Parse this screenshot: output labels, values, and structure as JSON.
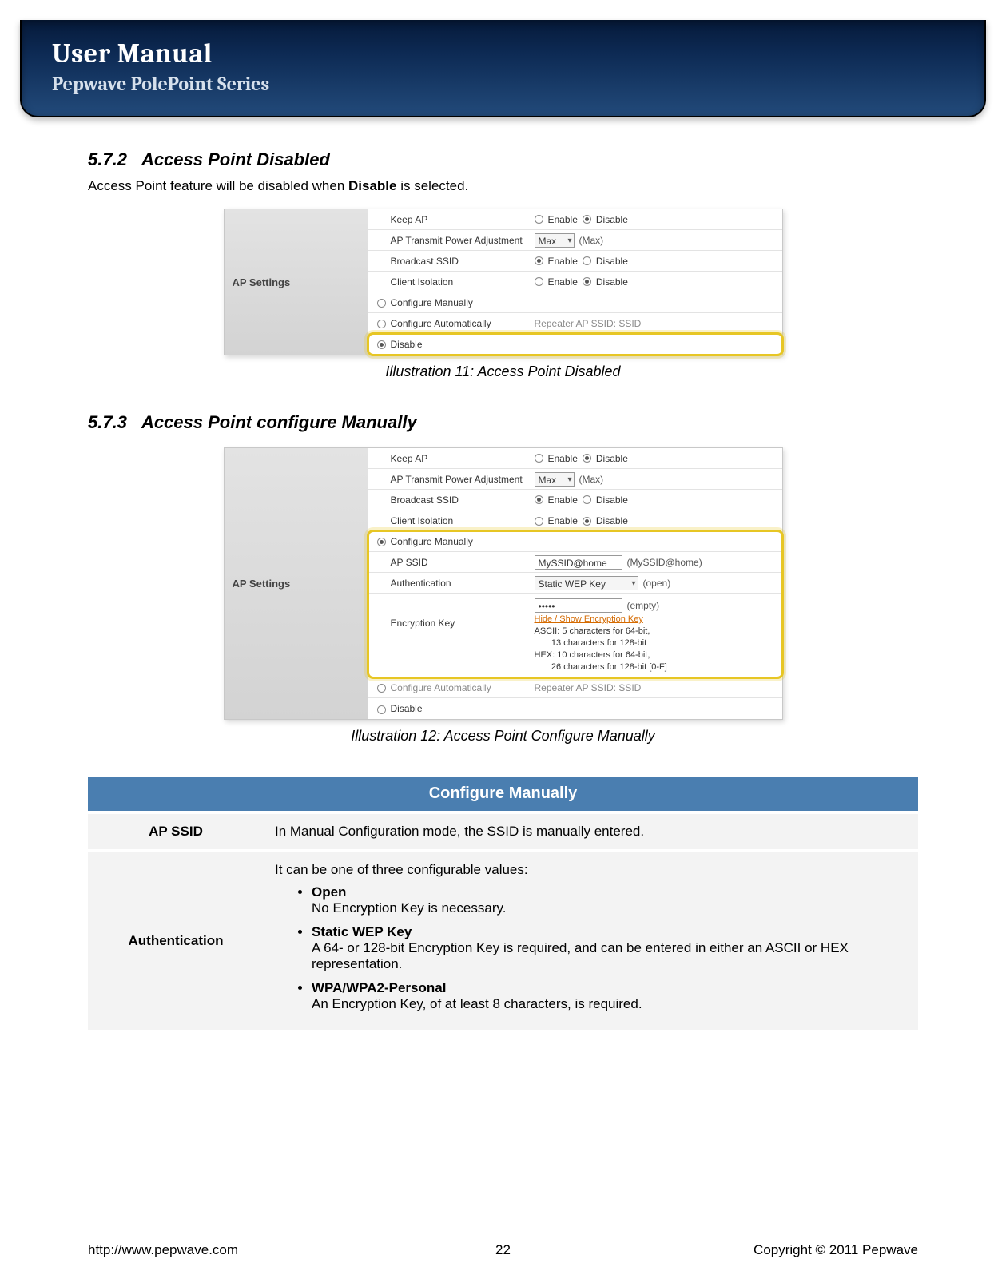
{
  "header": {
    "title": "User Manual",
    "subtitle": "Pepwave PolePoint Series"
  },
  "s572": {
    "num": "5.7.2",
    "title": "Access Point Disabled",
    "body_pre": "Access Point feature will be disabled when ",
    "body_bold": "Disable",
    "body_post": " is selected.",
    "caption": "Illustration 11: Access Point Disabled"
  },
  "panel_label": "AP Settings",
  "ui_common": {
    "keep_ap": "Keep AP",
    "tx_adj": "AP Transmit Power Adjustment",
    "tx_val": "Max",
    "tx_hint": "(Max)",
    "bcast": "Broadcast SSID",
    "iso": "Client Isolation",
    "enable": "Enable",
    "disable": "Disable",
    "cfg_man": "Configure Manually",
    "cfg_auto": "Configure Automatically",
    "repeater": "Repeater AP SSID: SSID",
    "disable_row": "Disable"
  },
  "s573": {
    "num": "5.7.3",
    "title": "Access Point configure Manually",
    "caption": "Illustration 12: Access Point Configure Manually",
    "ap_ssid_lbl": "AP SSID",
    "ap_ssid_val": "MySSID@home",
    "ap_ssid_hint": "(MySSID@home)",
    "auth_lbl": "Authentication",
    "auth_val": "Static WEP Key",
    "auth_hint": "(open)",
    "enc_lbl": "Encryption Key",
    "enc_val": "•••••",
    "enc_hint": "(empty)",
    "enc_link": "Hide / Show Encryption Key",
    "enc_help1": "ASCII: 5 characters for 64-bit,",
    "enc_help2": "13 characters for 128-bit",
    "enc_help3": "HEX: 10 characters for 64-bit,",
    "enc_help4": "26 characters for 128-bit [0-F]"
  },
  "cfg_table": {
    "header": "Configure Manually",
    "row1_key": "AP SSID",
    "row1_val": "In Manual Configuration mode, the SSID is manually entered.",
    "row2_key": "Authentication",
    "row2_intro": "It can be one of three configurable values:",
    "items": [
      {
        "title": "Open",
        "desc": "No Encryption Key is necessary."
      },
      {
        "title": "Static WEP Key",
        "desc": "A 64- or 128-bit Encryption Key is required, and can be entered in either an ASCII or HEX representation."
      },
      {
        "title": "WPA/WPA2-Personal",
        "desc": "An Encryption Key, of at least 8 characters, is required."
      }
    ]
  },
  "footer": {
    "left": "http://www.pepwave.com",
    "page": "22",
    "right": "Copyright © 2011 Pepwave"
  }
}
